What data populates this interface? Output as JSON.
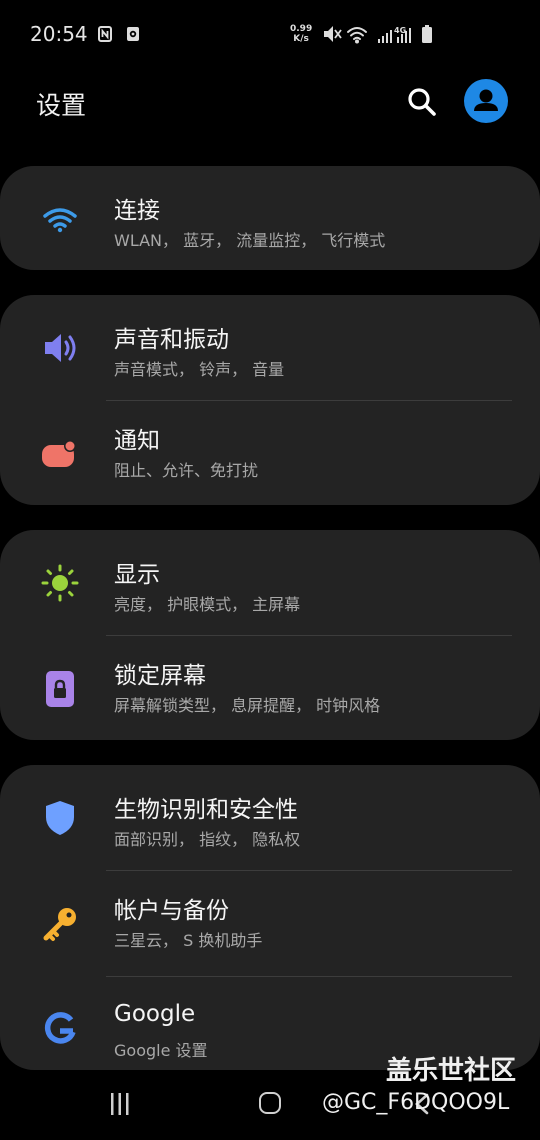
{
  "status": {
    "time": "20:54",
    "speed_value": "0.99",
    "speed_unit": "K/s",
    "network": "4G",
    "icons": [
      "nfc-icon",
      "screen-record-icon",
      "mute-icon",
      "wifi-icon",
      "signal-icon",
      "battery-icon"
    ]
  },
  "header": {
    "title": "设置"
  },
  "sections": [
    {
      "items": [
        {
          "label": "连接",
          "sub": "WLAN， 蓝牙， 流量监控， 飞行模式",
          "icon": "wifi-icon",
          "color": "#3d9be9"
        }
      ]
    },
    {
      "items": [
        {
          "label": "声音和振动",
          "sub": "声音模式， 铃声， 音量",
          "icon": "volume-icon",
          "color": "#7f7ff0"
        },
        {
          "label": "通知",
          "sub": "阻止、允许、免打扰",
          "icon": "notification-icon",
          "color": "#ef7468"
        }
      ]
    },
    {
      "items": [
        {
          "label": "显示",
          "sub": "亮度， 护眼模式， 主屏幕",
          "icon": "brightness-icon",
          "color": "#9bd33c"
        },
        {
          "label": "锁定屏幕",
          "sub": "屏幕解锁类型， 息屏提醒， 时钟风格",
          "icon": "lock-icon",
          "color": "#a983e8"
        }
      ]
    },
    {
      "items": [
        {
          "label": "生物识别和安全性",
          "sub": "面部识别， 指纹， 隐私权",
          "icon": "shield-icon",
          "color": "#6ea0ff"
        },
        {
          "label": "帐户与备份",
          "sub": "三星云， S 换机助手",
          "icon": "key-icon",
          "color": "#f7b030"
        },
        {
          "label": "Google",
          "sub": "Google 设置",
          "icon": "google-icon",
          "color": "#4a86ef"
        }
      ]
    }
  ],
  "watermark": {
    "main": "盖乐世社区",
    "sub": "@GC_F6DQOO9L"
  }
}
